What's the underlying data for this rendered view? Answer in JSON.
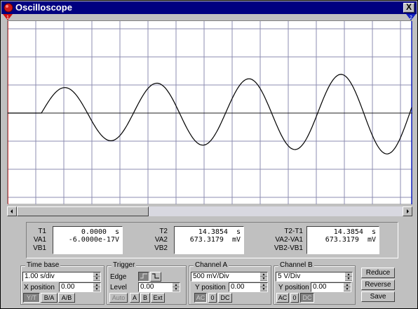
{
  "window": {
    "title": "Oscilloscope",
    "close_label": "X",
    "channel_markers": [
      "1",
      "2"
    ]
  },
  "colors": {
    "titlebar": "#000080",
    "trace": "#000000",
    "grid": "#8c8cb0",
    "marker_t1": "#d01010",
    "marker_t2": "#1020c0"
  },
  "screen": {
    "grid_divisions_x": 9.5,
    "grid_divisions_y": 6.5,
    "trace": {
      "flat_until_s": 1.0,
      "period_s": 6.5,
      "amplitude_div": 1.4,
      "growth_per_s": 0.055
    }
  },
  "scrollbar": {
    "position": 0.33
  },
  "readouts": {
    "t1": {
      "labels": [
        "T1",
        "VA1",
        "VB1"
      ],
      "values": [
        "0.0000  s",
        "-6.0000e-17V",
        ""
      ]
    },
    "t2": {
      "labels": [
        "T2",
        "VA2",
        "VB2"
      ],
      "values": [
        "14.3854  s",
        "673.3179  mV",
        ""
      ]
    },
    "delta": {
      "labels": [
        "T2-T1",
        "VA2-VA1",
        "VB2-VB1"
      ],
      "values": [
        "14.3854  s",
        "673.3179  mV",
        ""
      ]
    }
  },
  "timebase": {
    "title": "Time base",
    "scale": "1.00 s/div",
    "xpos_label": "X position",
    "xpos_value": "0.00",
    "modes": [
      "Y/T",
      "B/A",
      "A/B"
    ],
    "active_mode": "Y/T"
  },
  "trigger": {
    "title": "Trigger",
    "edge_label": "Edge",
    "level_label": "Level",
    "level_value": "0.00",
    "sources": [
      "Auto",
      "A",
      "B",
      "Ext"
    ]
  },
  "channel_a": {
    "title": "Channel A",
    "scale": "500 mV/Div",
    "ypos_label": "Y position",
    "ypos_value": "0.00",
    "couplings": [
      "AC",
      "0",
      "DC"
    ],
    "active_coupling": "AC"
  },
  "channel_b": {
    "title": "Channel B",
    "scale": "5 V/Div",
    "ypos_label": "Y position",
    "ypos_value": "0.00",
    "couplings": [
      "AC",
      "0",
      "DC"
    ],
    "active_coupling": "DC"
  },
  "actions": {
    "reduce": "Reduce",
    "reverse": "Reverse",
    "save": "Save"
  }
}
